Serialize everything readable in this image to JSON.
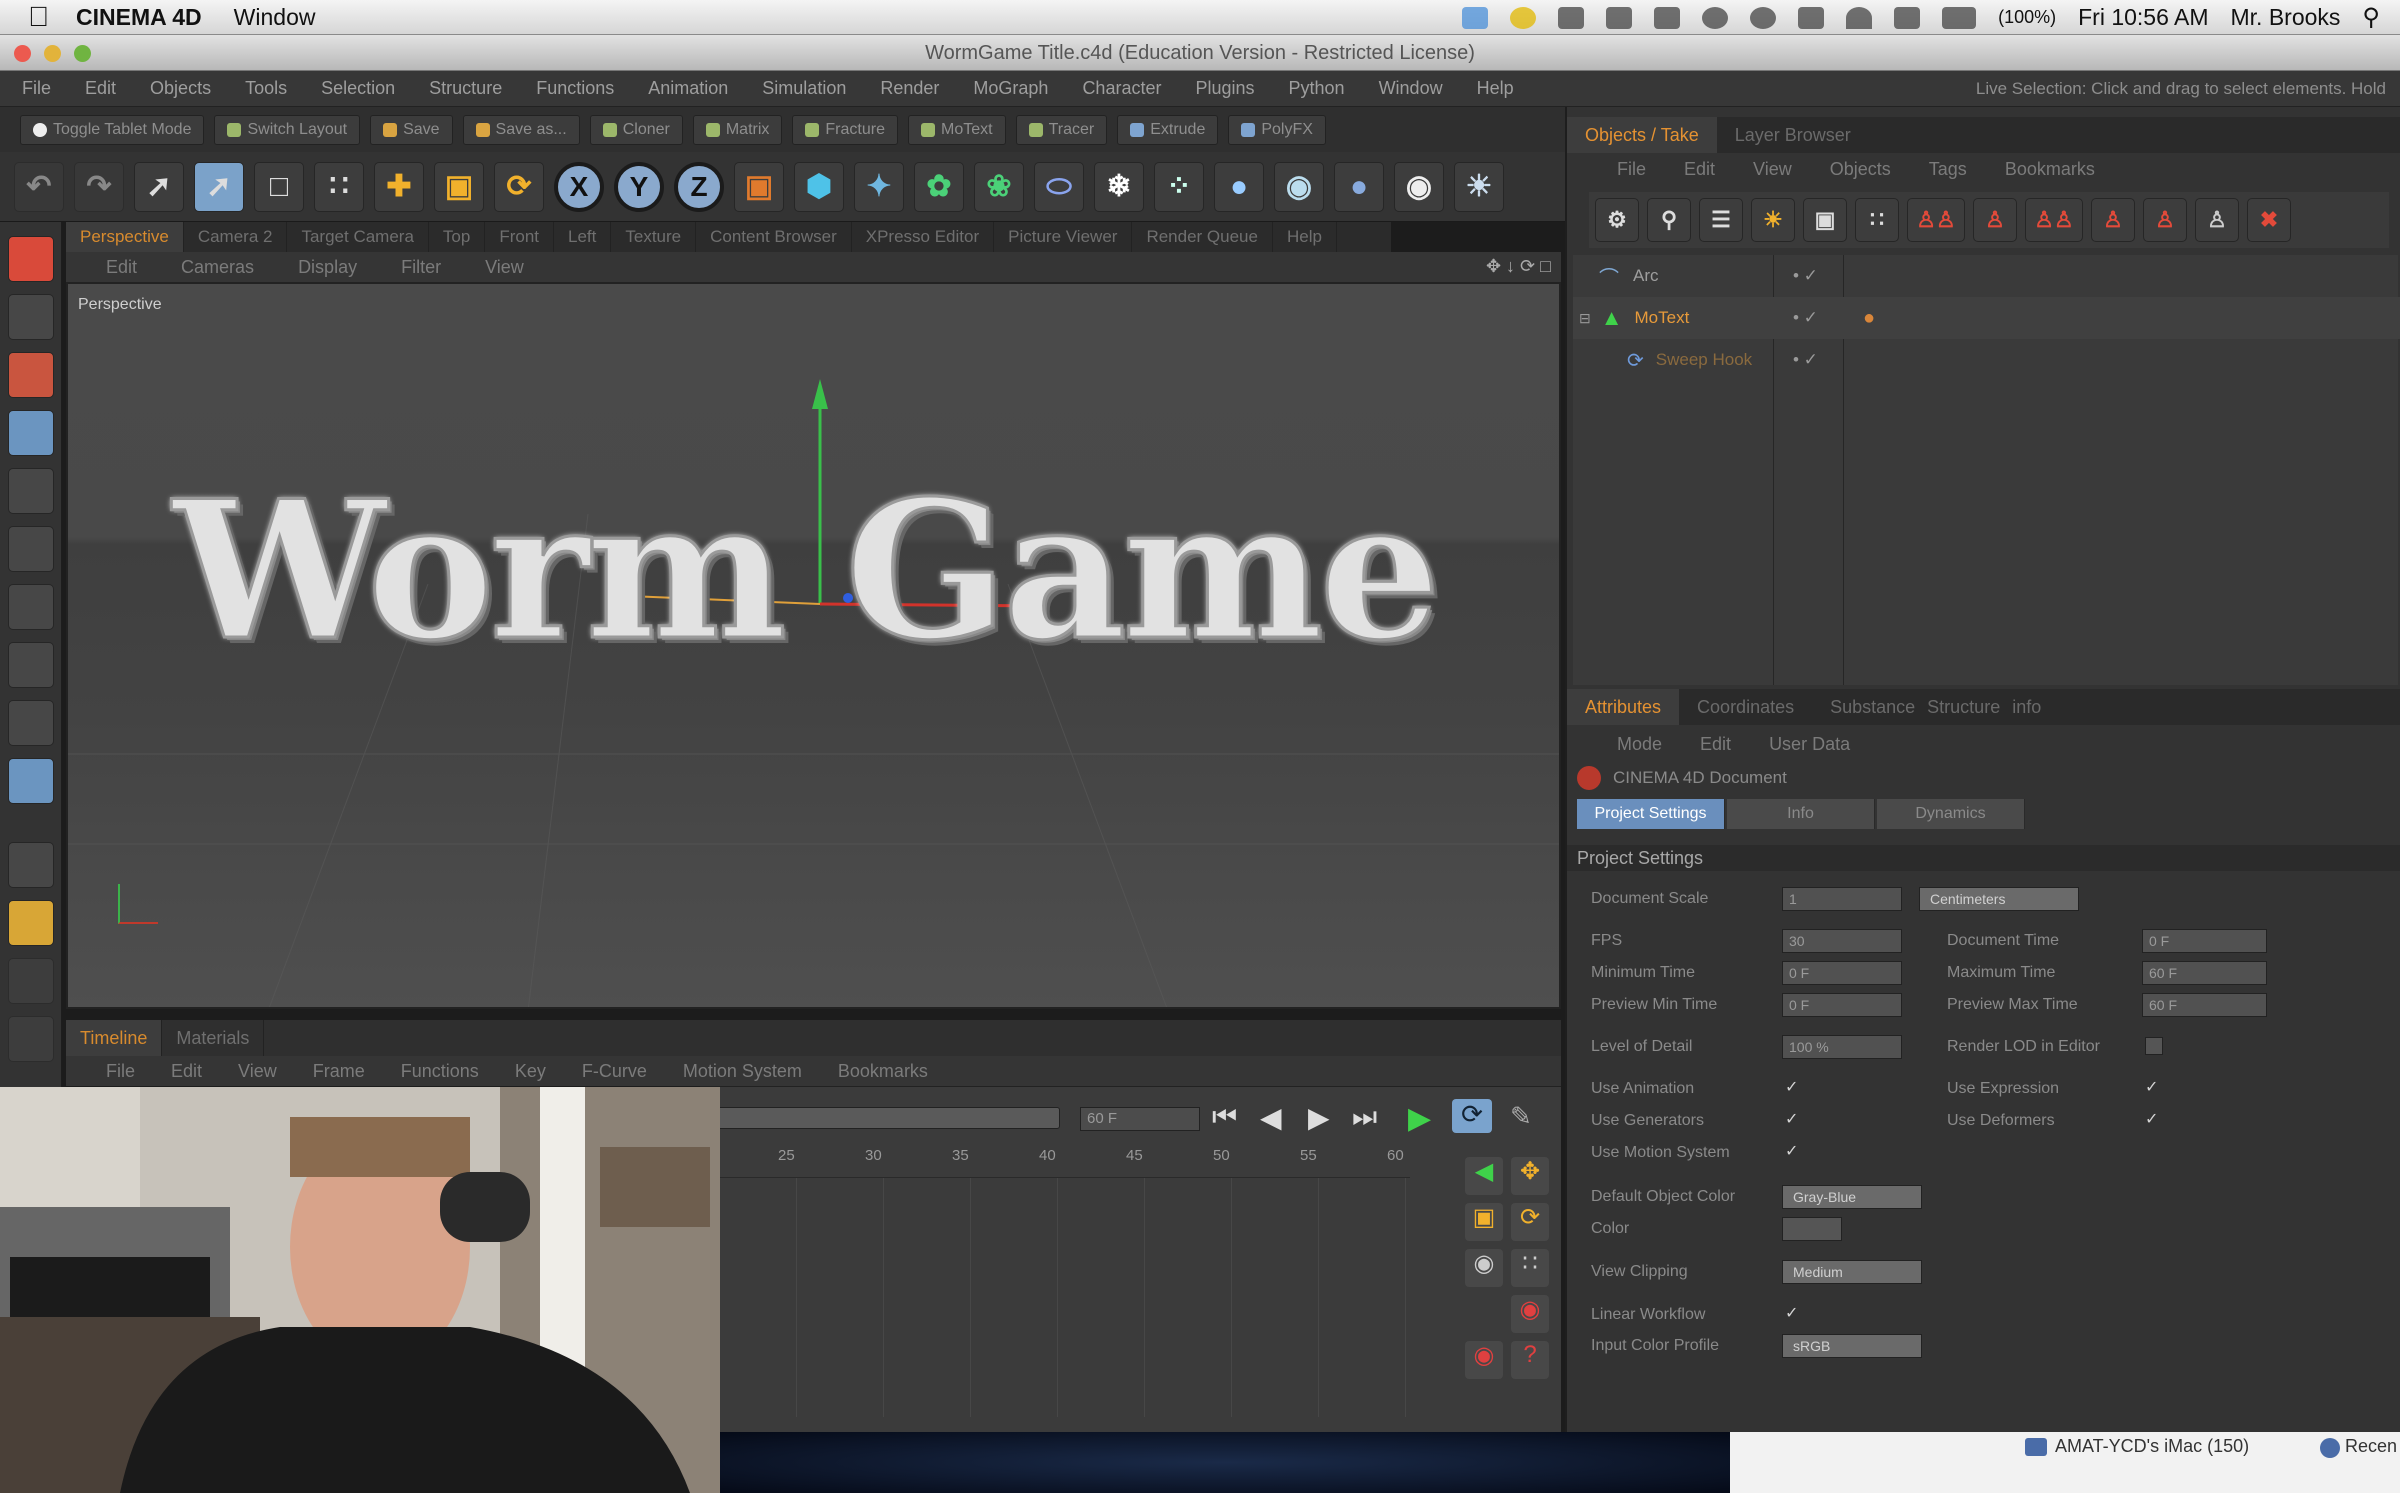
{
  "mac_menubar": {
    "app_name": "CINEMA 4D",
    "menu": [
      "Window"
    ],
    "battery": "(100%)",
    "clock": "Fri 10:56 AM",
    "user": "Mr. Brooks"
  },
  "window_title": "WormGame Title.c4d (Education Version - Restricted License)",
  "app_menu": [
    "File",
    "Edit",
    "Objects",
    "Tools",
    "Selection",
    "Structure",
    "Functions",
    "Animation",
    "Simulation",
    "Render",
    "MoGraph",
    "Character",
    "Plugins",
    "Python",
    "Window",
    "Help"
  ],
  "status_hint": "Live Selection: Click and drag to select elements. Hold",
  "command_buttons": [
    "Toggle Tablet Mode",
    "Switch Layout",
    "Save",
    "Save as...",
    "Cloner",
    "Matrix",
    "Fracture",
    "MoText",
    "Tracer",
    "Extrude",
    "PolyFX"
  ],
  "axis_locks": [
    "X",
    "Y",
    "Z"
  ],
  "viewport": {
    "tabs": [
      "Perspective",
      "Camera 2",
      "Target Camera",
      "Top",
      "Front",
      "Left",
      "Texture",
      "Content Browser",
      "XPresso Editor",
      "Picture Viewer",
      "Render Queue",
      "Help"
    ],
    "menu": [
      "Edit",
      "Cameras",
      "Display",
      "Filter",
      "View"
    ],
    "label": "Perspective",
    "scene_text": "Worm Game"
  },
  "timeline": {
    "tabs": [
      "Timeline",
      "Materials"
    ],
    "menu": [
      "File",
      "Edit",
      "View",
      "Frame",
      "Functions",
      "Key",
      "F-Curve",
      "Motion System",
      "Bookmarks"
    ],
    "frame_field": "60 F",
    "ruler": [
      "25",
      "30",
      "35",
      "40",
      "45",
      "50",
      "55",
      "60"
    ]
  },
  "objects_panel": {
    "tabs": [
      "Objects",
      "Take",
      "Layer Browser"
    ],
    "menu": [
      "File",
      "Edit",
      "View",
      "Objects",
      "Tags",
      "Bookmarks"
    ],
    "items": [
      {
        "name": "Arc"
      },
      {
        "name": "MoText"
      },
      {
        "name": "Sweep Hook"
      }
    ]
  },
  "attributes_panel": {
    "tabs": [
      "Attributes",
      "Coordinates",
      "Substance",
      "Structure",
      "info"
    ],
    "menu": [
      "Mode",
      "Edit",
      "User Data"
    ],
    "document_label": "CINEMA 4D Document",
    "subtabs": [
      "Project Settings",
      "Info",
      "Dynamics"
    ],
    "section_title": "Project Settings",
    "document_scale": {
      "label": "Document Scale",
      "value": "1",
      "unit": "Centimeters"
    },
    "left_fields": [
      {
        "label": "FPS",
        "value": "30"
      },
      {
        "label": "Minimum Time",
        "value": "0 F"
      },
      {
        "label": "Preview Min Time",
        "value": "0 F"
      },
      {
        "label": "Level of Detail",
        "value": "100 %"
      }
    ],
    "right_fields": [
      {
        "label": "Document Time",
        "value": "0 F"
      },
      {
        "label": "Maximum Time",
        "value": "60 F"
      },
      {
        "label": "Preview Max Time",
        "value": "60 F"
      },
      {
        "label": "Render LOD in Editor",
        "value": ""
      }
    ],
    "left_checks": [
      "Use Animation",
      "Use Generators",
      "Use Motion System"
    ],
    "right_checks": [
      "Use Expression",
      "Use Deformers"
    ],
    "default_object_color": {
      "label": "Default Object Color",
      "value": "Gray-Blue"
    },
    "color_label": "Color",
    "view_clipping": {
      "label": "View Clipping",
      "value": "Medium"
    },
    "linear_workflow": "Linear Workflow",
    "input_color_profile": {
      "label": "Input Color Profile",
      "value": "sRGB"
    }
  },
  "dock_items": [
    "AMAT-YCD's iMac (150)",
    "Recen"
  ]
}
